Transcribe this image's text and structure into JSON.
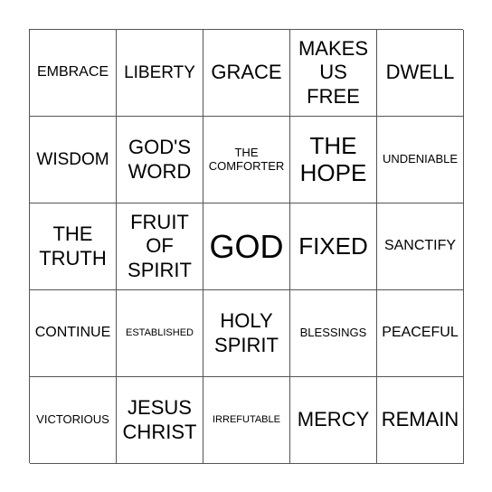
{
  "card": {
    "rows": [
      [
        "EMBRACE",
        "LIBERTY",
        "GRACE",
        "MAKES\nUS\nFREE",
        "DWELL"
      ],
      [
        "WISDOM",
        "GOD'S\nWORD",
        "THE\nCOMFORTER",
        "THE\nHOPE",
        "UNDENIABLE"
      ],
      [
        "THE\nTRUTH",
        "FRUIT\nOF\nSPIRIT",
        "GOD",
        "FIXED",
        "SANCTIFY"
      ],
      [
        "CONTINUE",
        "ESTABLISHED",
        "HOLY\nSPIRIT",
        "BLESSINGS",
        "PEACEFUL"
      ],
      [
        "VICTORIOUS",
        "JESUS\nCHRIST",
        "IRREFUTABLE",
        "MERCY",
        "REMAIN"
      ]
    ]
  }
}
